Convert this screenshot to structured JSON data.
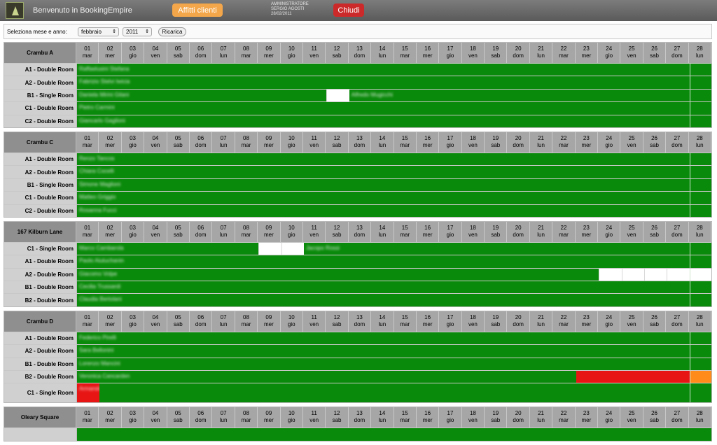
{
  "app": {
    "title": "Benvenuto in BookingEmpire",
    "affitti_label": "Affitti clienti",
    "chiudi_label": "Chiudi",
    "user_role": "AMMINISTRATORE",
    "user_name": "SERGIO AGOSTI",
    "user_date": "28/02/2011"
  },
  "selector": {
    "label": "Seleziona mese e anno:",
    "month": "febbraio",
    "year": "2011",
    "reload_label": "Ricarica"
  },
  "days": [
    {
      "n": "01",
      "d": "mar"
    },
    {
      "n": "02",
      "d": "mer"
    },
    {
      "n": "03",
      "d": "gio"
    },
    {
      "n": "04",
      "d": "ven"
    },
    {
      "n": "05",
      "d": "sab"
    },
    {
      "n": "06",
      "d": "dom"
    },
    {
      "n": "07",
      "d": "lun"
    },
    {
      "n": "08",
      "d": "mar"
    },
    {
      "n": "09",
      "d": "mer"
    },
    {
      "n": "10",
      "d": "gio"
    },
    {
      "n": "11",
      "d": "ven"
    },
    {
      "n": "12",
      "d": "sab"
    },
    {
      "n": "13",
      "d": "dom"
    },
    {
      "n": "14",
      "d": "lun"
    },
    {
      "n": "15",
      "d": "mar"
    },
    {
      "n": "16",
      "d": "mer"
    },
    {
      "n": "17",
      "d": "gio"
    },
    {
      "n": "18",
      "d": "ven"
    },
    {
      "n": "19",
      "d": "sab"
    },
    {
      "n": "20",
      "d": "dom"
    },
    {
      "n": "21",
      "d": "lun"
    },
    {
      "n": "22",
      "d": "mar"
    },
    {
      "n": "23",
      "d": "mer"
    },
    {
      "n": "24",
      "d": "gio"
    },
    {
      "n": "25",
      "d": "ven"
    },
    {
      "n": "26",
      "d": "sab"
    },
    {
      "n": "27",
      "d": "dom"
    },
    {
      "n": "28",
      "d": "lun"
    }
  ],
  "colors": {
    "booked": "#0a8a0a",
    "free": "#ffffff",
    "red": "#e81515",
    "orange": "#ff8c1a"
  },
  "properties": [
    {
      "name": "Crambu A",
      "rooms": [
        {
          "label": "A1 - Double Room",
          "segments": [
            {
              "from": 1,
              "to": 27,
              "color": "green",
              "guest": "Raffaelusini Stefana"
            },
            {
              "from": 28,
              "to": 28,
              "color": "green"
            }
          ]
        },
        {
          "label": "A2 - Double Room",
          "segments": [
            {
              "from": 1,
              "to": 27,
              "color": "green",
              "guest": "Fabrizio Stelvi Iwicia"
            },
            {
              "from": 28,
              "to": 28,
              "color": "green"
            }
          ]
        },
        {
          "label": "B1 - Single Room",
          "segments": [
            {
              "from": 1,
              "to": 11,
              "color": "green",
              "guest": "Daniela Mirini Gilani"
            },
            {
              "from": 12,
              "to": 12,
              "color": "white"
            },
            {
              "from": 13,
              "to": 27,
              "color": "green",
              "guest": "Alfredo Mugicchi"
            },
            {
              "from": 28,
              "to": 28,
              "color": "green"
            }
          ]
        },
        {
          "label": "C1 - Double Room",
          "segments": [
            {
              "from": 1,
              "to": 27,
              "color": "green",
              "guest": "Pietro Carmini"
            },
            {
              "from": 28,
              "to": 28,
              "color": "green"
            }
          ]
        },
        {
          "label": "C2 - Double Room",
          "segments": [
            {
              "from": 1,
              "to": 27,
              "color": "green",
              "guest": "Giancarlo Gaglioni"
            },
            {
              "from": 28,
              "to": 28,
              "color": "green"
            }
          ]
        }
      ]
    },
    {
      "name": "Crambu C",
      "rooms": [
        {
          "label": "A1 - Double Room",
          "segments": [
            {
              "from": 1,
              "to": 27,
              "color": "green",
              "guest": "Renzo Tancos"
            },
            {
              "from": 28,
              "to": 28,
              "color": "green"
            }
          ]
        },
        {
          "label": "A2 - Double Room",
          "segments": [
            {
              "from": 1,
              "to": 27,
              "color": "green",
              "guest": "Chiara Cocelli"
            },
            {
              "from": 28,
              "to": 28,
              "color": "green"
            }
          ]
        },
        {
          "label": "B1 - Single Room",
          "segments": [
            {
              "from": 1,
              "to": 27,
              "color": "green",
              "guest": "Simone Maglioni"
            },
            {
              "from": 28,
              "to": 28,
              "color": "green"
            }
          ]
        },
        {
          "label": "C1 - Double Room",
          "segments": [
            {
              "from": 1,
              "to": 27,
              "color": "green",
              "guest": "Matteo Griggio"
            },
            {
              "from": 28,
              "to": 28,
              "color": "green"
            }
          ]
        },
        {
          "label": "C2 - Double Room",
          "segments": [
            {
              "from": 1,
              "to": 27,
              "color": "green",
              "guest": "Rosanna Fucci"
            },
            {
              "from": 28,
              "to": 28,
              "color": "green"
            }
          ]
        }
      ]
    },
    {
      "name": "167 Kilburn Lane",
      "rooms": [
        {
          "label": "C1 - Single Room",
          "segments": [
            {
              "from": 1,
              "to": 8,
              "color": "green",
              "guest": "Marco Cambarola"
            },
            {
              "from": 9,
              "to": 9,
              "color": "white"
            },
            {
              "from": 10,
              "to": 10,
              "color": "white"
            },
            {
              "from": 11,
              "to": 27,
              "color": "green",
              "guest": "Jacopo Rossi"
            },
            {
              "from": 28,
              "to": 28,
              "color": "green"
            }
          ]
        },
        {
          "label": "A1 - Double Room",
          "segments": [
            {
              "from": 1,
              "to": 27,
              "color": "green",
              "guest": "Paolo Aiutuchanin"
            },
            {
              "from": 28,
              "to": 28,
              "color": "green"
            }
          ]
        },
        {
          "label": "A2 - Double Room",
          "segments": [
            {
              "from": 1,
              "to": 23,
              "color": "green",
              "guest": "Giacomo Volpe"
            },
            {
              "from": 24,
              "to": 24,
              "color": "white"
            },
            {
              "from": 25,
              "to": 25,
              "color": "white"
            },
            {
              "from": 26,
              "to": 26,
              "color": "white"
            },
            {
              "from": 27,
              "to": 27,
              "color": "white"
            },
            {
              "from": 28,
              "to": 28,
              "color": "white"
            }
          ]
        },
        {
          "label": "B1 - Double Room",
          "segments": [
            {
              "from": 1,
              "to": 27,
              "color": "green",
              "guest": "Cecilia Trussardi"
            },
            {
              "from": 28,
              "to": 28,
              "color": "green"
            }
          ]
        },
        {
          "label": "B2 - Double Room",
          "segments": [
            {
              "from": 1,
              "to": 27,
              "color": "green",
              "guest": "Claudia Bertolani"
            },
            {
              "from": 28,
              "to": 28,
              "color": "green"
            }
          ]
        }
      ]
    },
    {
      "name": "Crambu D",
      "rooms": [
        {
          "label": "A1 - Double Room",
          "segments": [
            {
              "from": 1,
              "to": 27,
              "color": "green",
              "guest": "Federico Pirelli"
            },
            {
              "from": 28,
              "to": 28,
              "color": "green"
            }
          ]
        },
        {
          "label": "A2 - Double Room",
          "segments": [
            {
              "from": 1,
              "to": 27,
              "color": "green",
              "guest": "Sara Bellonini"
            },
            {
              "from": 28,
              "to": 28,
              "color": "green"
            }
          ]
        },
        {
          "label": "B1 - Double Room",
          "segments": [
            {
              "from": 1,
              "to": 27,
              "color": "green",
              "guest": "Lorenzo Mancini"
            },
            {
              "from": 28,
              "to": 28,
              "color": "green"
            }
          ]
        },
        {
          "label": "B2 - Double Room",
          "segments": [
            {
              "from": 1,
              "to": 22,
              "color": "green",
              "guest": "Veronica Cancarden"
            },
            {
              "from": 23,
              "to": 27,
              "color": "red"
            },
            {
              "from": 28,
              "to": 28,
              "color": "orange"
            }
          ]
        },
        {
          "label": "C1 - Single Room",
          "tall": true,
          "segments": [
            {
              "from": 1,
              "to": 1,
              "color": "red",
              "guest": "Armando Rubino"
            },
            {
              "from": 2,
              "to": 27,
              "color": "green"
            },
            {
              "from": 28,
              "to": 28,
              "color": "green"
            }
          ]
        }
      ]
    },
    {
      "name": "Oleary Square",
      "rooms": []
    }
  ]
}
